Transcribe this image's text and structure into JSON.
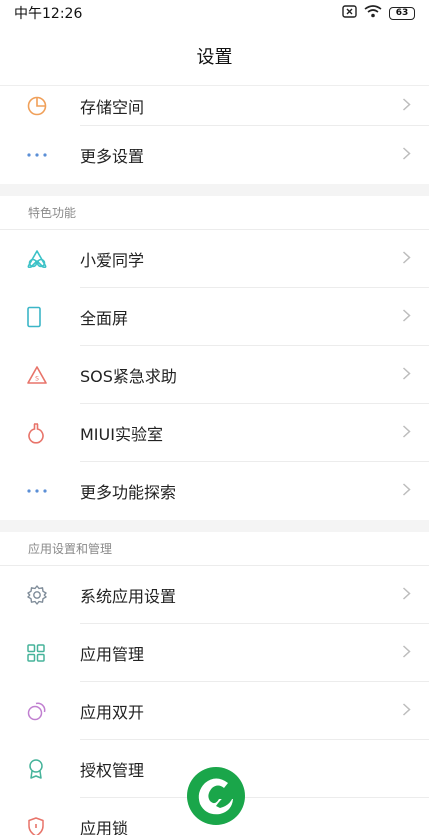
{
  "status": {
    "time": "中午12:26",
    "battery": "63"
  },
  "header": {
    "title": "设置"
  },
  "top_items": [
    {
      "label": "存储空间",
      "icon": "pie-chart-icon"
    },
    {
      "label": "更多设置",
      "icon": "more-dots-icon"
    }
  ],
  "section_features": {
    "title": "特色功能",
    "items": [
      {
        "label": "小爱同学",
        "icon": "xiaoai-icon"
      },
      {
        "label": "全面屏",
        "icon": "phone-screen-icon"
      },
      {
        "label": "SOS紧急求助",
        "icon": "sos-icon"
      },
      {
        "label": "MIUI实验室",
        "icon": "lab-flask-icon"
      },
      {
        "label": "更多功能探索",
        "icon": "more-dots-icon"
      }
    ]
  },
  "section_apps": {
    "title": "应用设置和管理",
    "items": [
      {
        "label": "系统应用设置",
        "icon": "gear-icon"
      },
      {
        "label": "应用管理",
        "icon": "grid-icon"
      },
      {
        "label": "应用双开",
        "icon": "dual-apps-icon"
      },
      {
        "label": "授权管理",
        "icon": "badge-icon"
      },
      {
        "label": "应用锁",
        "icon": "shield-lock-icon"
      }
    ]
  },
  "colors": {
    "accent_green": "#1aa64a",
    "chevron": "#bdbdbd",
    "divider": "#ececec",
    "section_bg": "#f4f4f4"
  }
}
